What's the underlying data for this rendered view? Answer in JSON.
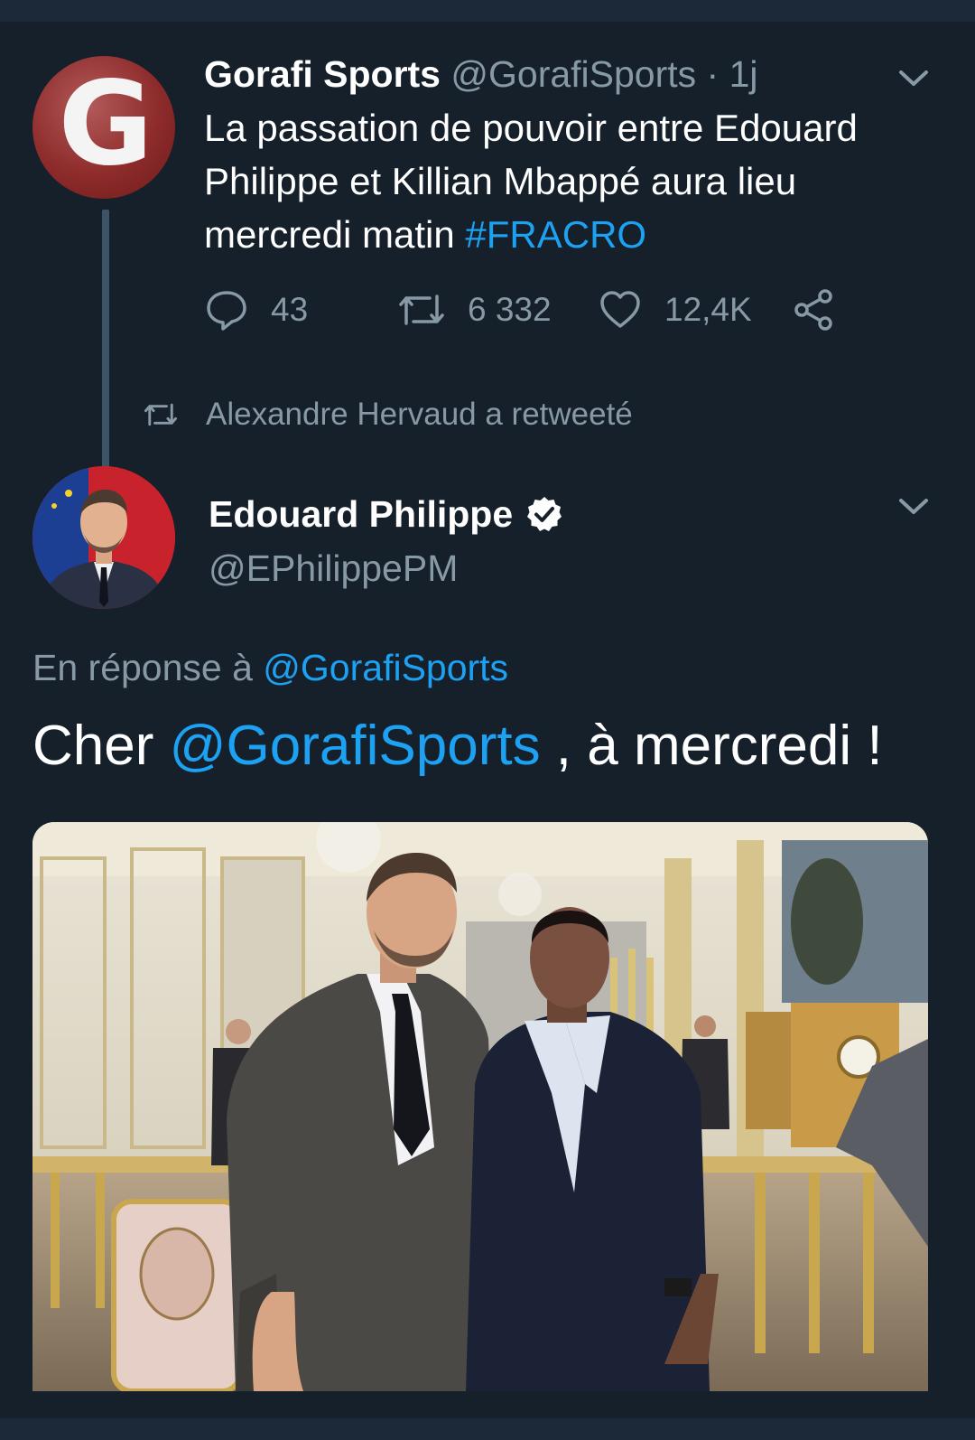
{
  "tweet1": {
    "author_name": "Gorafi Sports",
    "author_handle_meta": "@GorafiSports · 1j",
    "avatar_letter": "G",
    "text_parts": [
      "La passation de pouvoir entre Edouard Philippe et Killian Mbappé aura lieu mercredi matin ",
      "#FRACRO"
    ],
    "replies": "43",
    "retweets": "6 332",
    "likes": "12,4K"
  },
  "retweet_label": "Alexandre Hervaud a retweeté",
  "tweet2": {
    "author_name": "Edouard Philippe",
    "author_handle": "@EPhilippePM",
    "reply_prefix": "En réponse à ",
    "reply_mention": "@GorafiSports",
    "text_prefix": "Cher ",
    "text_mention": "@GorafiSports",
    "text_suffix": " , à mercredi !"
  },
  "colors": {
    "background": "#15202b",
    "accent": "#1da1f2",
    "secondary_text": "#8899a6"
  }
}
